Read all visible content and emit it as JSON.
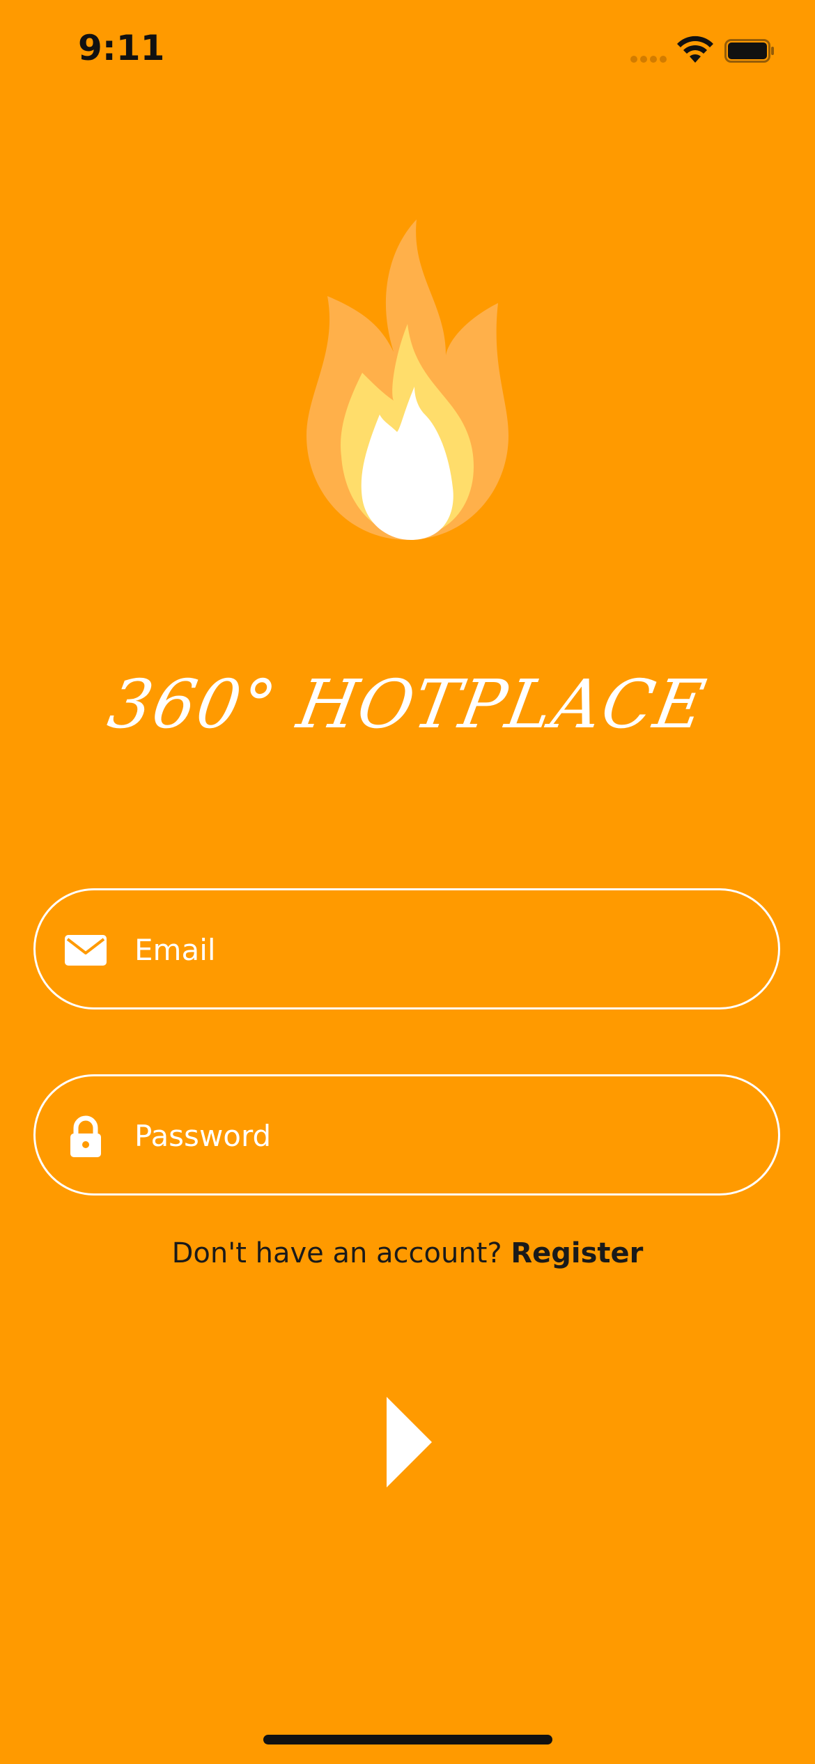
{
  "status_bar": {
    "time": "9:11"
  },
  "brand": {
    "title": "360° HOTPLACE"
  },
  "login": {
    "email_placeholder": "Email",
    "password_placeholder": "Password"
  },
  "register": {
    "prompt": "Don't have an account? ",
    "link": "Register"
  },
  "icons": {
    "wifi": "wifi-icon",
    "battery": "battery-icon",
    "flame": "flame-icon",
    "email": "envelope-icon",
    "password": "lock-icon",
    "submit": "play-triangle-icon"
  },
  "colors": {
    "background": "#FF9A00",
    "flame_outer": "#FFB04A",
    "flame_middle": "#FFDD6B",
    "flame_inner": "#FFFFFF"
  }
}
